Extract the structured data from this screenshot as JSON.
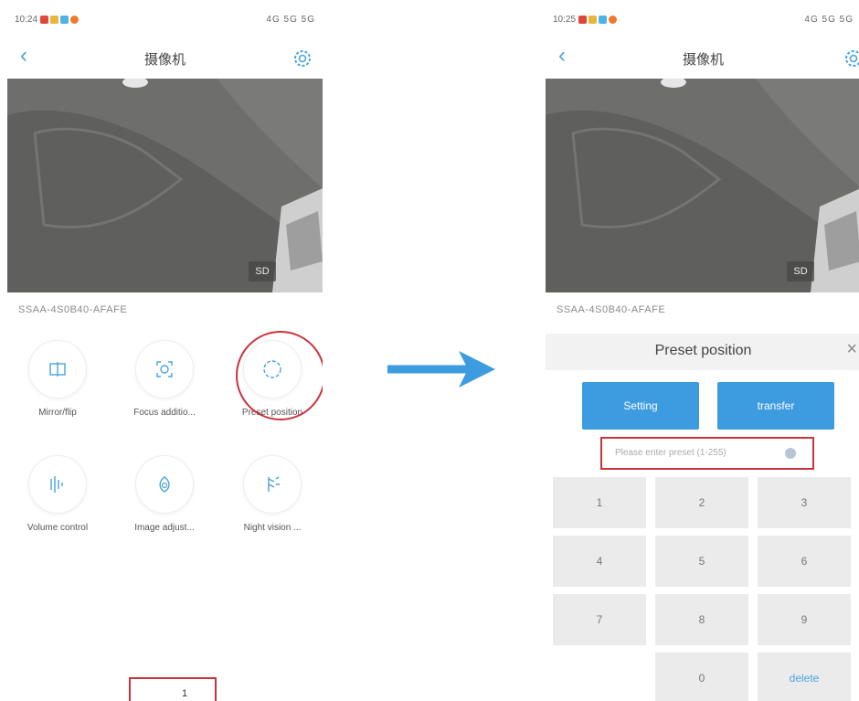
{
  "left_screen": {
    "status_time": "10:24",
    "status_icons": "4G 5G 5G",
    "nav_title": "摄像机",
    "video_badge": "SD",
    "device_name": "SSAA-4S0B40-AFAFE",
    "controls": [
      {
        "label": "Mirror/flip",
        "icon": "mirror-icon"
      },
      {
        "label": "Focus additio...",
        "icon": "focus-icon"
      },
      {
        "label": "Preset position",
        "icon": "preset-icon"
      },
      {
        "label": "Volume control",
        "icon": "volume-icon"
      },
      {
        "label": "Image adjust...",
        "icon": "image-adjust-icon"
      },
      {
        "label": "Night vision ...",
        "icon": "night-vision-icon"
      }
    ],
    "page_indicator": "1"
  },
  "right_screen": {
    "status_time": "10:25",
    "status_icons": "4G 5G 5G",
    "nav_title": "摄像机",
    "video_badge": "SD",
    "device_name": "SSAA-4S0B40-AFAFE",
    "panel_title": "Preset position",
    "close_symbol": "×",
    "setting_label": "Setting",
    "transfer_label": "transfer",
    "preset_placeholder": "Please enter preset (1-255)",
    "keys": [
      "1",
      "2",
      "3",
      "4",
      "5",
      "6",
      "7",
      "8",
      "9",
      "0",
      "delete"
    ]
  },
  "colors": {
    "accent": "#3d9be0",
    "highlight": "#c9333a",
    "arrow": "#3d9be0"
  }
}
